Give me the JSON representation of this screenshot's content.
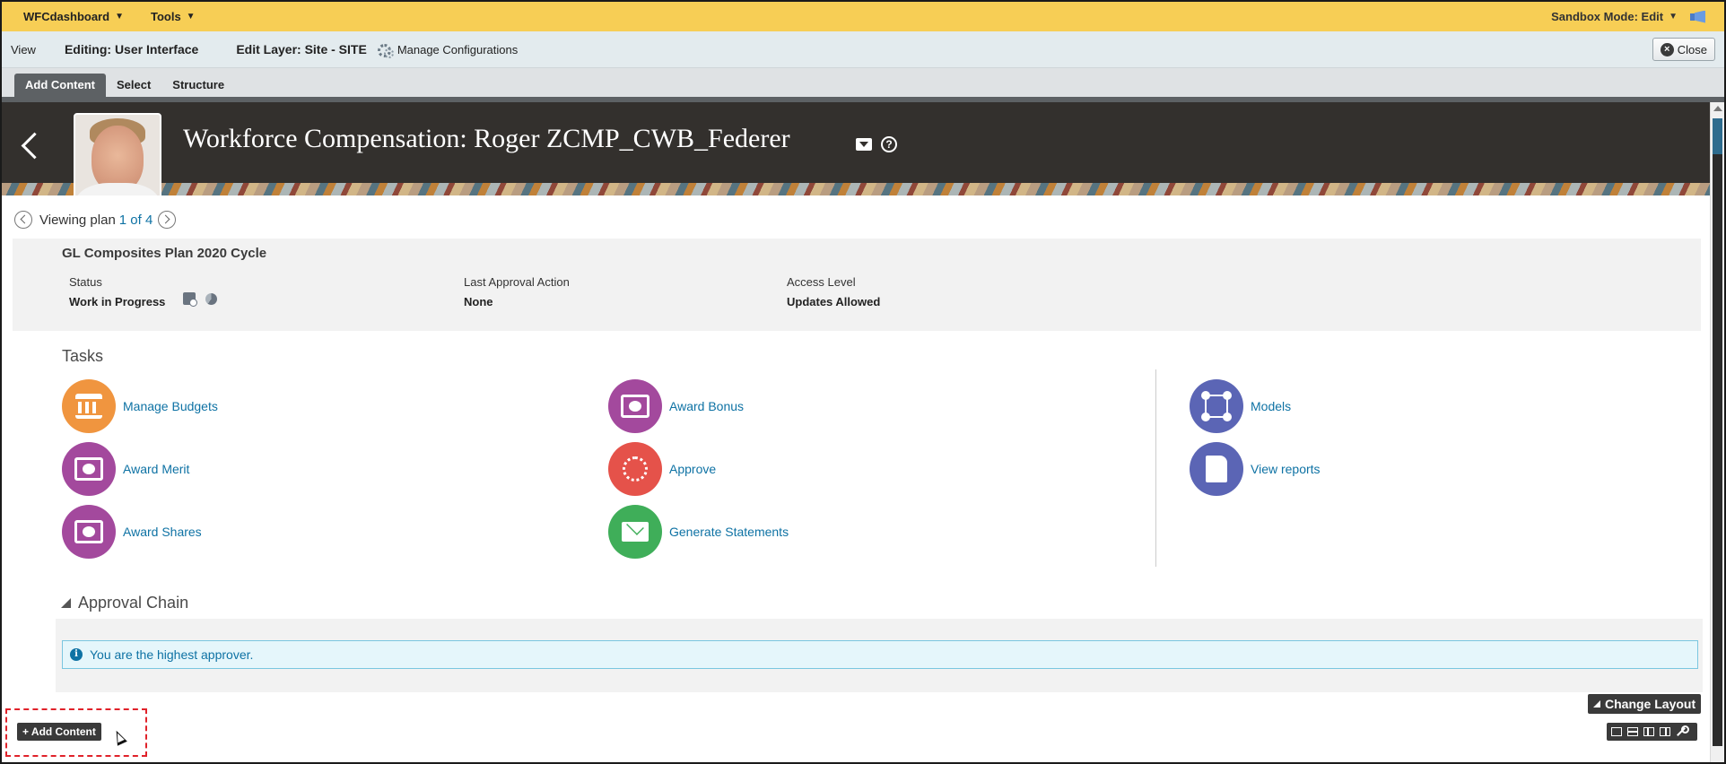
{
  "topbar": {
    "menus": [
      {
        "label": "WFCdashboard"
      },
      {
        "label": "Tools"
      }
    ],
    "sandbox_mode": "Sandbox Mode: Edit"
  },
  "editbar": {
    "view": "View",
    "editing": "Editing: User Interface",
    "layer": "Edit Layer: Site - SITE",
    "manage": "Manage Configurations",
    "close": "Close"
  },
  "tabs": [
    {
      "label": "Add Content",
      "active": true
    },
    {
      "label": "Select",
      "active": false
    },
    {
      "label": "Structure",
      "active": false
    }
  ],
  "header": {
    "title": "Workforce Compensation: Roger ZCMP_CWB_Federer",
    "help": "?"
  },
  "viewing": {
    "label": "Viewing plan",
    "link": "1 of 4"
  },
  "plan": {
    "title": "GL Composites Plan 2020 Cycle",
    "status_label": "Status",
    "status_value": "Work in Progress",
    "approval_label": "Last Approval Action",
    "approval_value": "None",
    "access_label": "Access Level",
    "access_value": "Updates Allowed"
  },
  "tasks": {
    "title": "Tasks",
    "items": [
      {
        "label": "Manage Budgets",
        "icon": "bank-icon",
        "color": "#f0953f"
      },
      {
        "label": "Award Merit",
        "icon": "cash-icon",
        "color": "#a3499d"
      },
      {
        "label": "Award Shares",
        "icon": "cash-icon",
        "color": "#a3499d"
      },
      {
        "label": "Award Bonus",
        "icon": "cash-icon",
        "color": "#a3499d"
      },
      {
        "label": "Approve",
        "icon": "ring-icon",
        "color": "#e5524a"
      },
      {
        "label": "Generate Statements",
        "icon": "envelope-icon",
        "color": "#3fae59"
      },
      {
        "label": "Models",
        "icon": "nodes-icon",
        "color": "#5b65b5"
      },
      {
        "label": "View reports",
        "icon": "report-icon",
        "color": "#5b65b5"
      }
    ]
  },
  "approval": {
    "title": "Approval Chain",
    "message": "You are the highest approver."
  },
  "footer": {
    "change_layout": "Change Layout",
    "add_content": "+ Add Content"
  }
}
